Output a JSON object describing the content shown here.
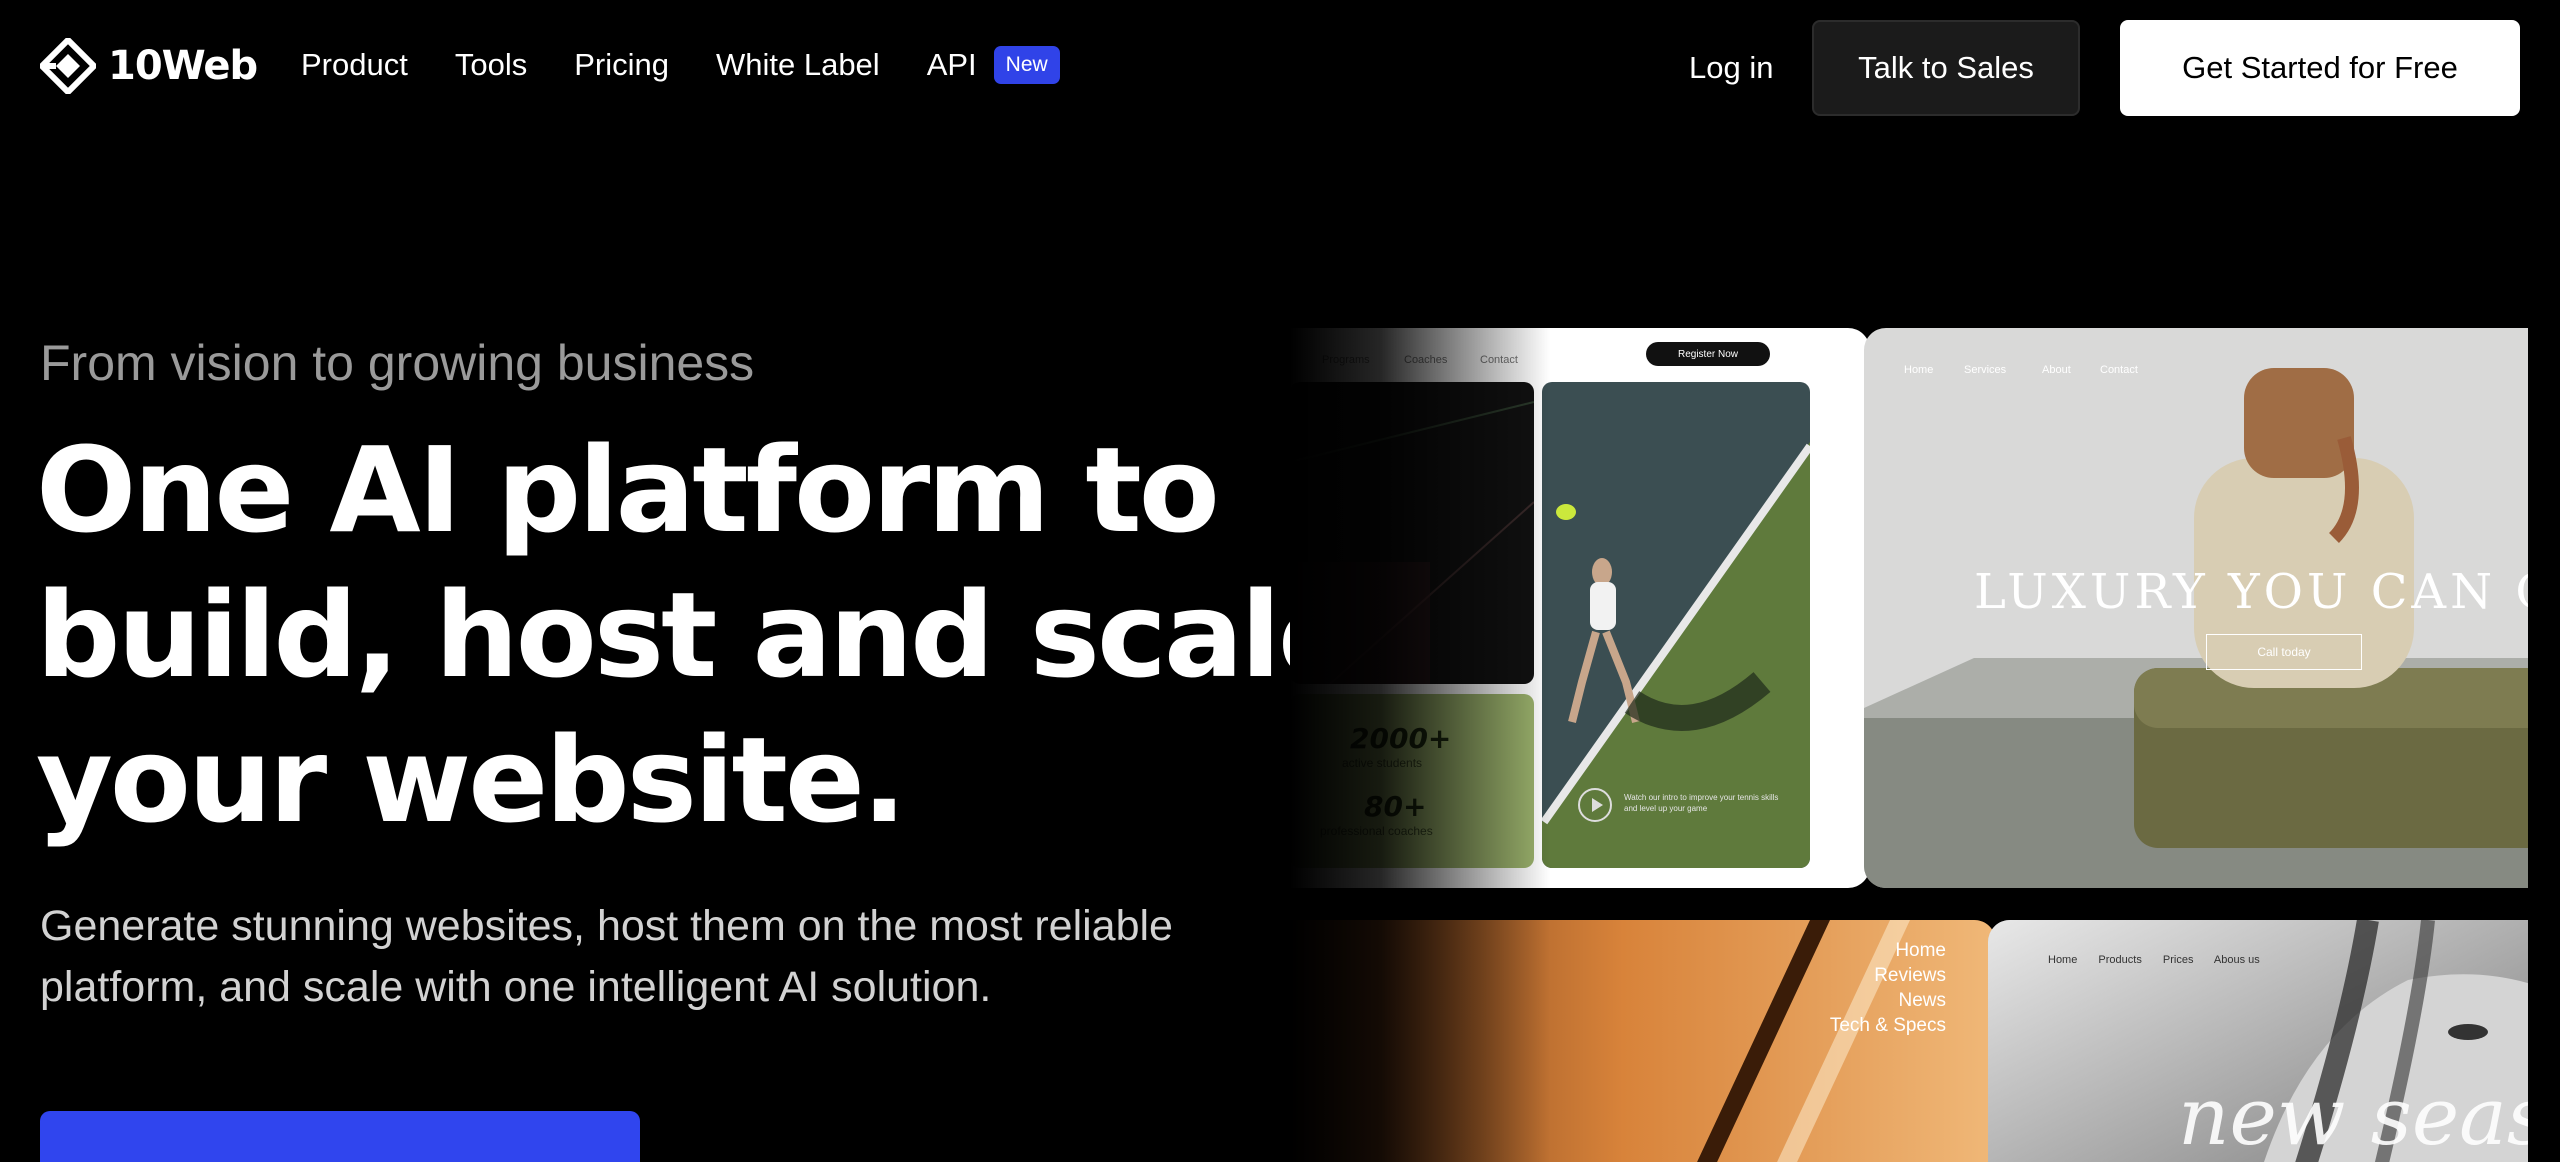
{
  "brand": {
    "name": "10Web"
  },
  "nav": {
    "links": [
      "Product",
      "Tools",
      "Pricing",
      "White Label",
      "API"
    ],
    "api_badge": "New",
    "login": "Log in",
    "talk_to_sales": "Talk to Sales",
    "get_started": "Get Started for Free"
  },
  "hero": {
    "eyebrow": "From vision to growing business",
    "title_lines": [
      "One AI platform to",
      "build, host and scale",
      "your website."
    ],
    "subtitle": "Generate stunning websites, host them on the most reliable platform, and scale with one intelligent AI solution."
  },
  "showcase": {
    "tennis": {
      "nav": [
        "Programs",
        "Coaches",
        "Contact"
      ],
      "register": "Register Now",
      "stat1_value": "2000+",
      "stat1_label": "active students",
      "stat2_value": "80+",
      "stat2_label": "professional coaches",
      "caption": "Watch our intro to improve your tennis skills and level up your game"
    },
    "luxury": {
      "nav": [
        "Home",
        "Services",
        "About",
        "Contact"
      ],
      "title": "LUXURY YOU CAN CAR",
      "button": "Call today"
    },
    "orange": {
      "links": [
        "Home",
        "Reviews",
        "News",
        "Tech & Specs"
      ]
    },
    "fashion": {
      "nav": [
        "Home",
        "Products",
        "Prices",
        "Abous us"
      ],
      "title": "new seas"
    }
  },
  "colors": {
    "accent": "#3045ee",
    "background": "#000000",
    "muted_text": "#9a9a9a"
  }
}
